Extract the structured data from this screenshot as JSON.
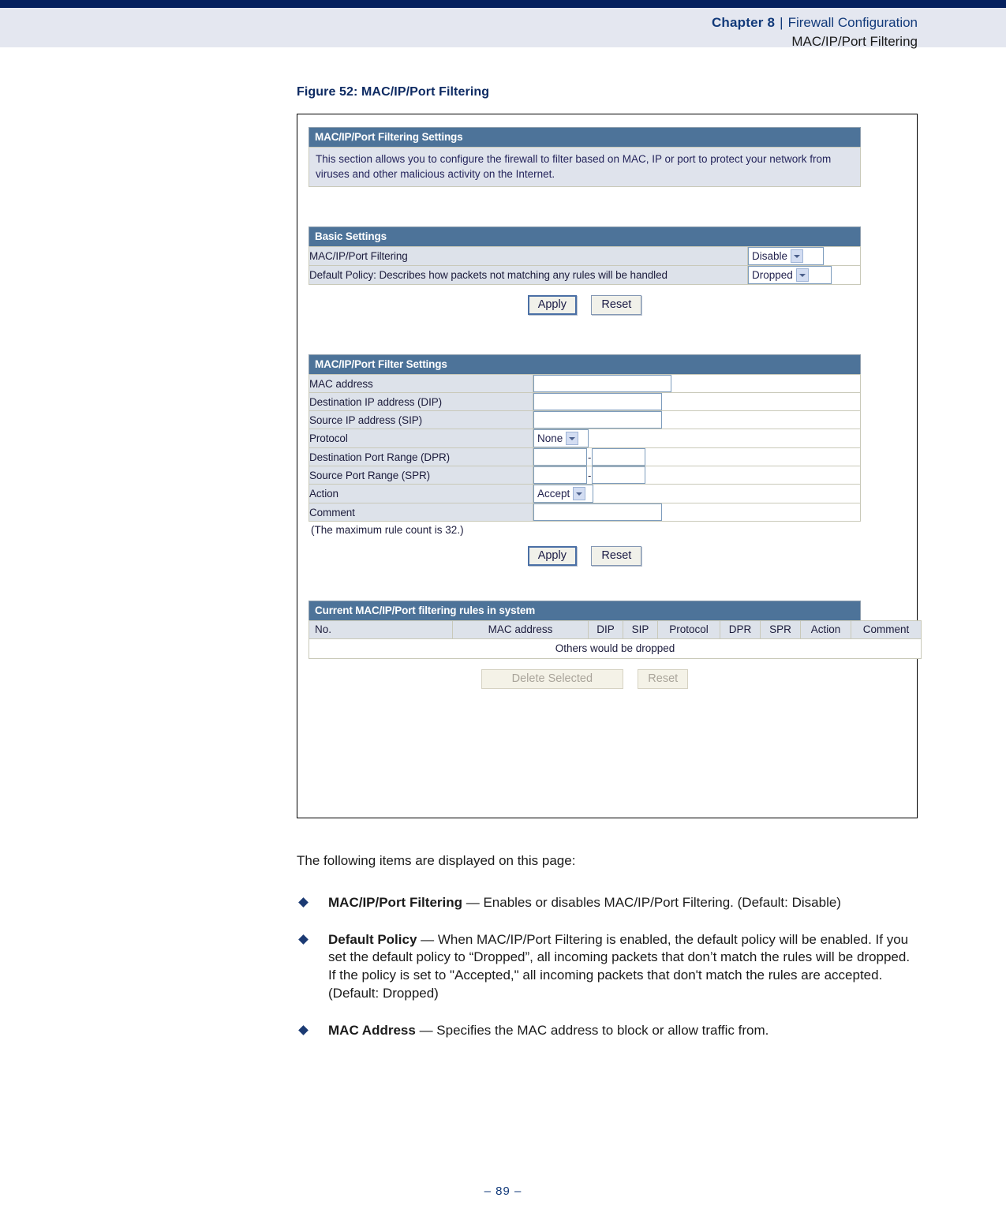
{
  "header": {
    "chapter_label": "Chapter 8",
    "separator": "|",
    "section": "Firewall Configuration",
    "subsection": "MAC/IP/Port Filtering"
  },
  "figure": {
    "caption": "Figure 52:  MAC/IP/Port Filtering"
  },
  "screen": {
    "settings_panel": {
      "title": "MAC/IP/Port Filtering Settings",
      "description": "This section allows you to configure the firewall to filter based on MAC, IP or port to protect your network from viruses and other malicious activity on the Internet."
    },
    "basic_settings": {
      "title": "Basic Settings",
      "rows": [
        {
          "label": "MAC/IP/Port Filtering",
          "value": "Disable"
        },
        {
          "label": "Default Policy: Describes how packets not matching any rules will be handled",
          "value": "Dropped"
        }
      ],
      "apply_label": "Apply",
      "reset_label": "Reset"
    },
    "filter_settings": {
      "title": "MAC/IP/Port Filter Settings",
      "labels": {
        "mac_address": "MAC address",
        "dip": "Destination IP address (DIP)",
        "sip": "Source IP address (SIP)",
        "protocol": "Protocol",
        "dpr": "Destination Port Range (DPR)",
        "spr": "Source Port Range (SPR)",
        "action": "Action",
        "comment": "Comment"
      },
      "values": {
        "mac_address": "",
        "dip": "",
        "sip": "",
        "protocol": "None",
        "dpr_from": "",
        "dpr_to": "",
        "spr_from": "",
        "spr_to": "",
        "action": "Accept",
        "comment": ""
      },
      "range_separator": "-",
      "note": "(The maximum rule count is 32.)",
      "apply_label": "Apply",
      "reset_label": "Reset"
    },
    "rules_table": {
      "title": "Current MAC/IP/Port filtering rules in system",
      "columns": [
        "No.",
        "MAC address",
        "DIP",
        "SIP",
        "Protocol",
        "DPR",
        "SPR",
        "Action",
        "Comment"
      ],
      "rows": [],
      "empty_message": "Others would be dropped",
      "delete_label": "Delete Selected",
      "reset_label": "Reset"
    }
  },
  "body": {
    "intro": "The following items are displayed on this page:",
    "bullets": [
      {
        "term": "MAC/IP/Port Filtering",
        "text": " — Enables or disables MAC/IP/Port Filtering. (Default: Disable)"
      },
      {
        "term": "Default Policy",
        "text": " — When MAC/IP/Port Filtering is enabled, the default policy will be enabled. If you set the default policy to “Dropped”, all incoming packets that don’t match the rules will be dropped. If the policy is set to \"Accepted,\" all incoming packets that don't match the rules are accepted. (Default: Dropped)"
      },
      {
        "term": "MAC Address",
        "text": " — Specifies the MAC address to block or allow traffic from."
      }
    ]
  },
  "footer": {
    "page_number": "–  89  –"
  },
  "colors": {
    "top_rule": "#04205e",
    "header_band": "#e4e7f0",
    "panel_title_bg": "#4d7399",
    "label_cell_bg": "#dde2ea",
    "accent_text": "#123a7a"
  }
}
